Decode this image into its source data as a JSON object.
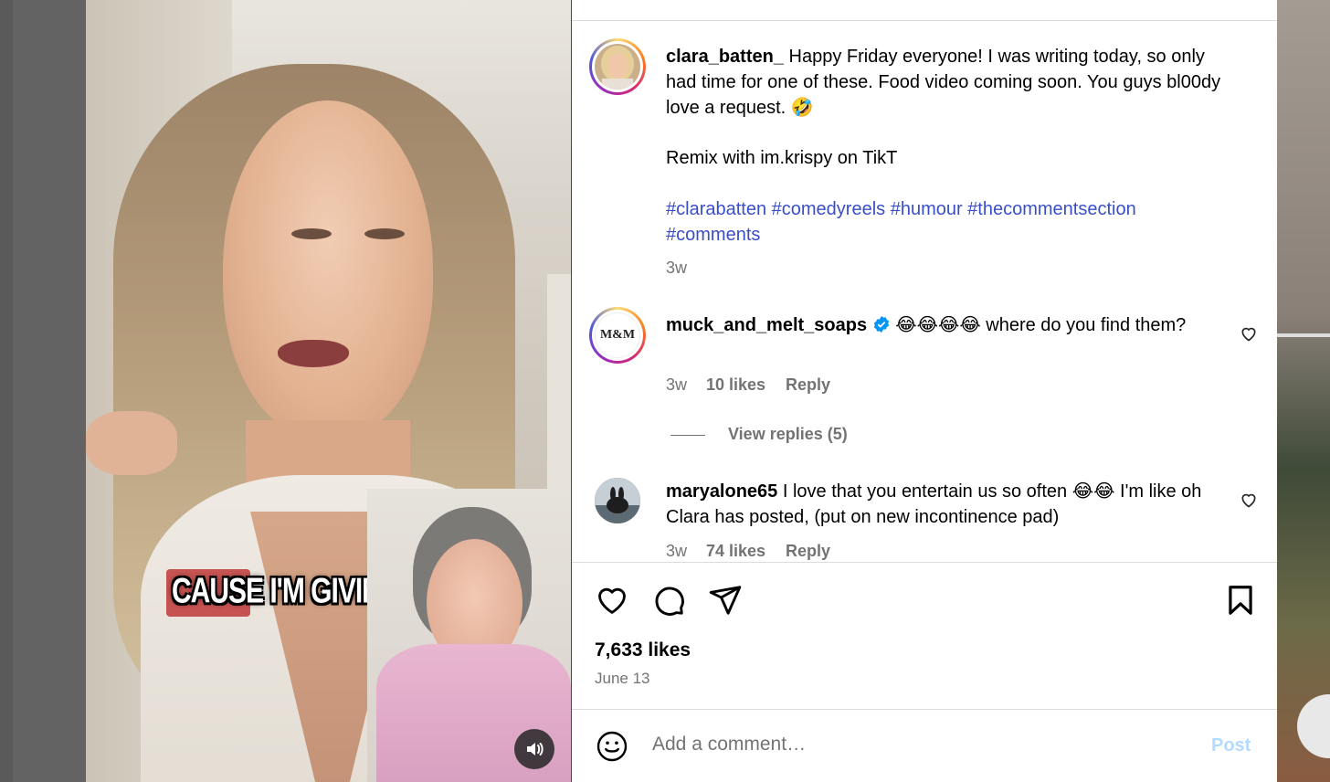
{
  "video": {
    "caption_text": "CAUSE I'M GIVING",
    "sound_icon": "speaker-icon"
  },
  "post": {
    "username": "clara_batten_",
    "caption_line1": "Happy Friday everyone! I was writing today, so only had time for one of these. Food video coming soon. You guys bl00dy love a request. 🤣",
    "caption_line2": "Remix with im.krispy on TikT",
    "hashtags": "#clarabatten #comedyreels #humour #thecommentsection #comments",
    "age": "3w"
  },
  "comments": [
    {
      "username": "muck_and_melt_soaps",
      "verified": true,
      "text": "😂😂😂😂 where do you find them?",
      "age": "3w",
      "likes": "10 likes",
      "reply": "Reply",
      "view_replies": "View replies (5)",
      "avatar_text": "M&M"
    },
    {
      "username": "maryalone65",
      "verified": false,
      "text": "I love that you entertain us so often 😂😂 I'm like oh Clara has posted, (put on new incontinence pad)",
      "age": "3w",
      "likes": "74 likes",
      "reply": "Reply"
    }
  ],
  "actions": {
    "likes_count": "7,633 likes",
    "date": "June 13"
  },
  "comment_box": {
    "placeholder": "Add a comment…",
    "post_label": "Post"
  },
  "colors": {
    "hashtag": "#3a4fc7",
    "post_button_disabled": "#b3dbff",
    "secondary_text": "#737373"
  }
}
